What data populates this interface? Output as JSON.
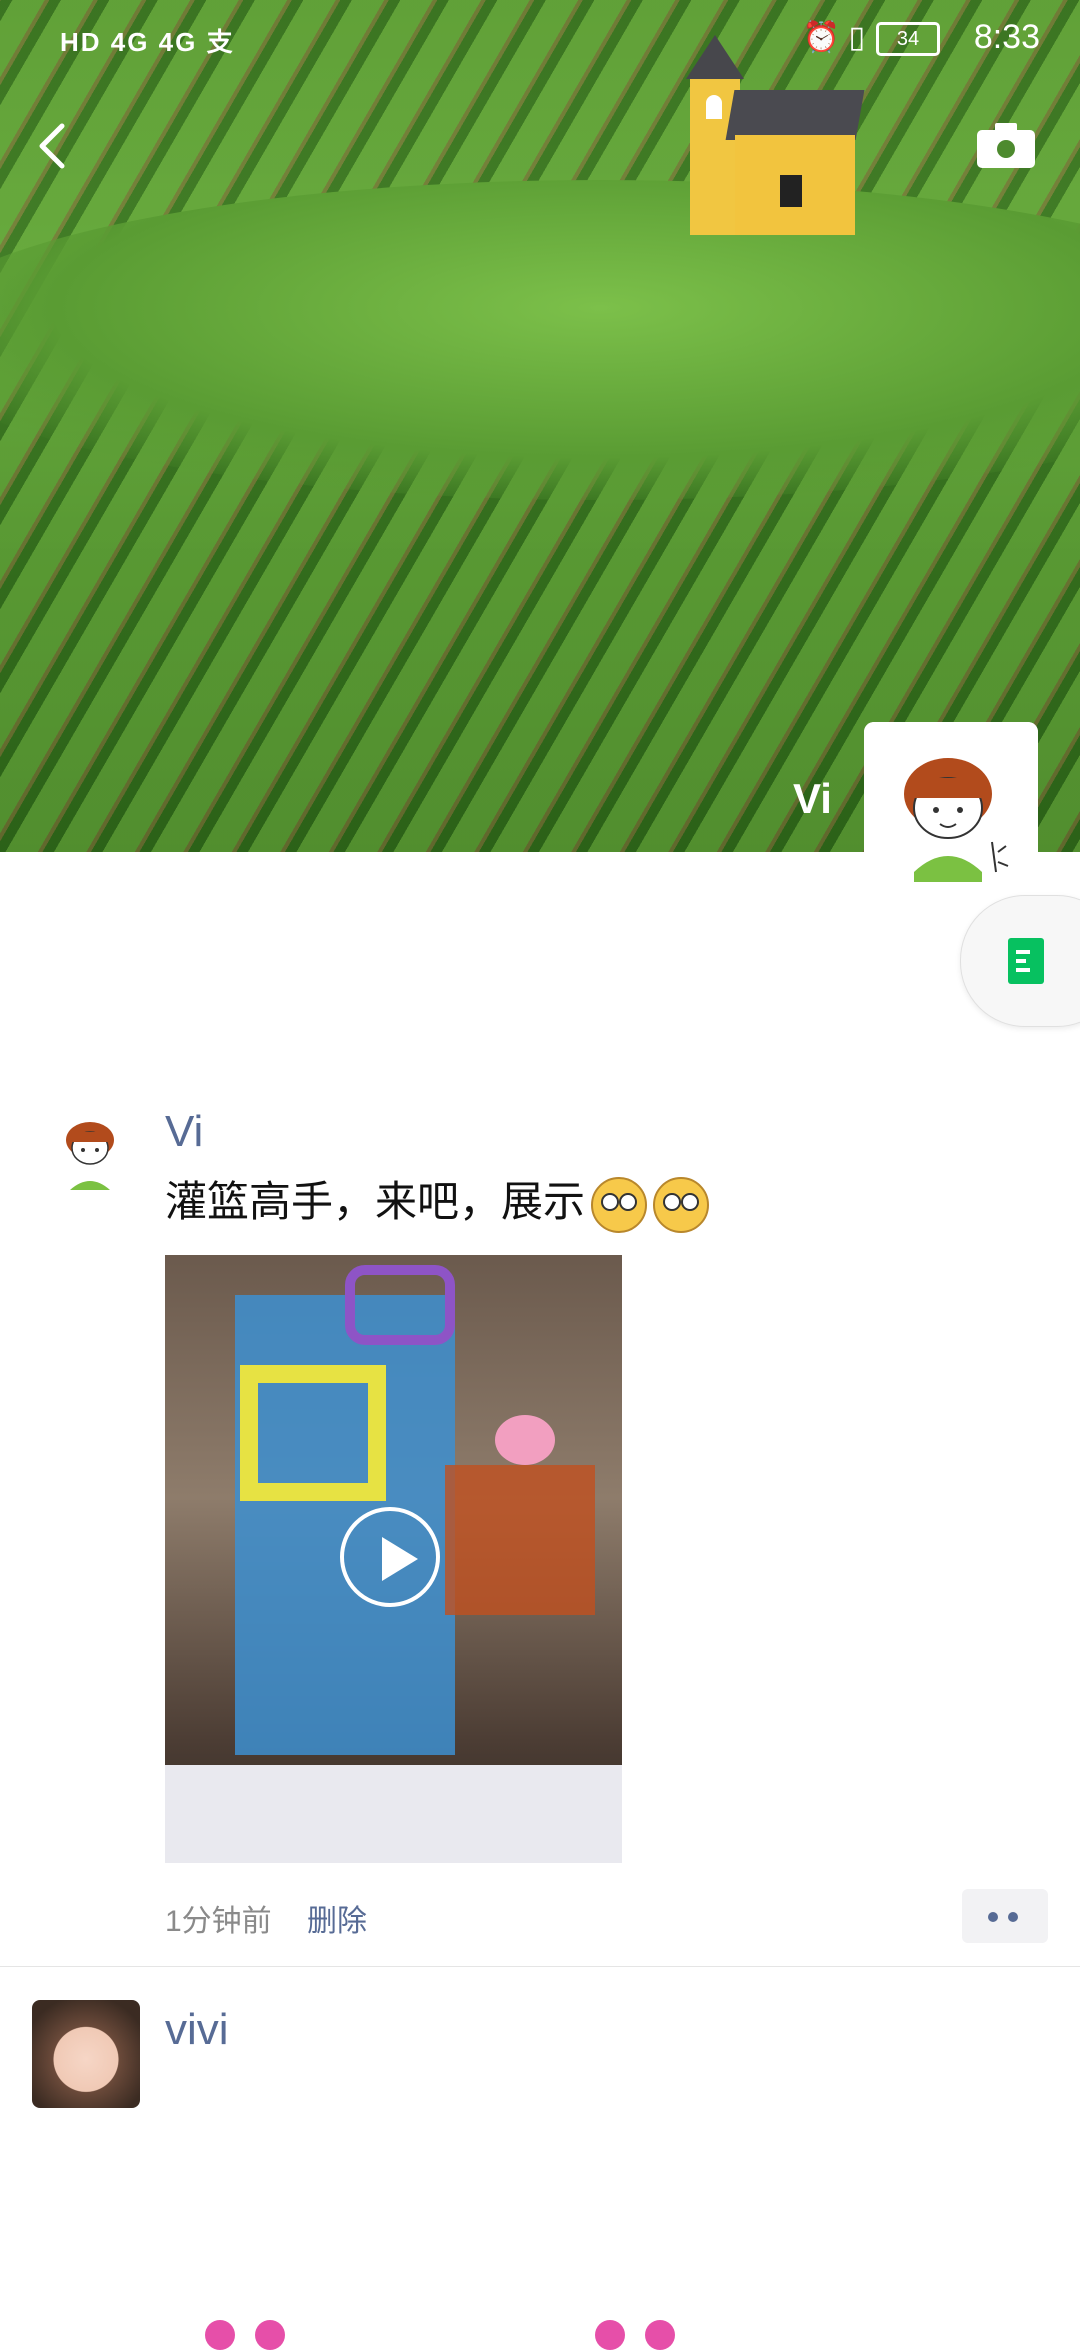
{
  "status_bar": {
    "left_indicators": "HD 4G 4G 支",
    "battery": "34",
    "time": "8:33"
  },
  "header": {
    "back_icon": "chevron-left-icon",
    "camera_icon": "camera-icon",
    "user_name": "Vi"
  },
  "floating_button": {
    "icon": "document-icon",
    "color": "#07c160"
  },
  "posts": [
    {
      "author": "Vi",
      "text": "灌篮高手，来吧，展示",
      "media_type": "video",
      "time": "1分钟前",
      "delete_label": "删除"
    },
    {
      "author": "vivi"
    }
  ],
  "colors": {
    "link": "#576b95",
    "meta_text": "#8a8a8a"
  }
}
